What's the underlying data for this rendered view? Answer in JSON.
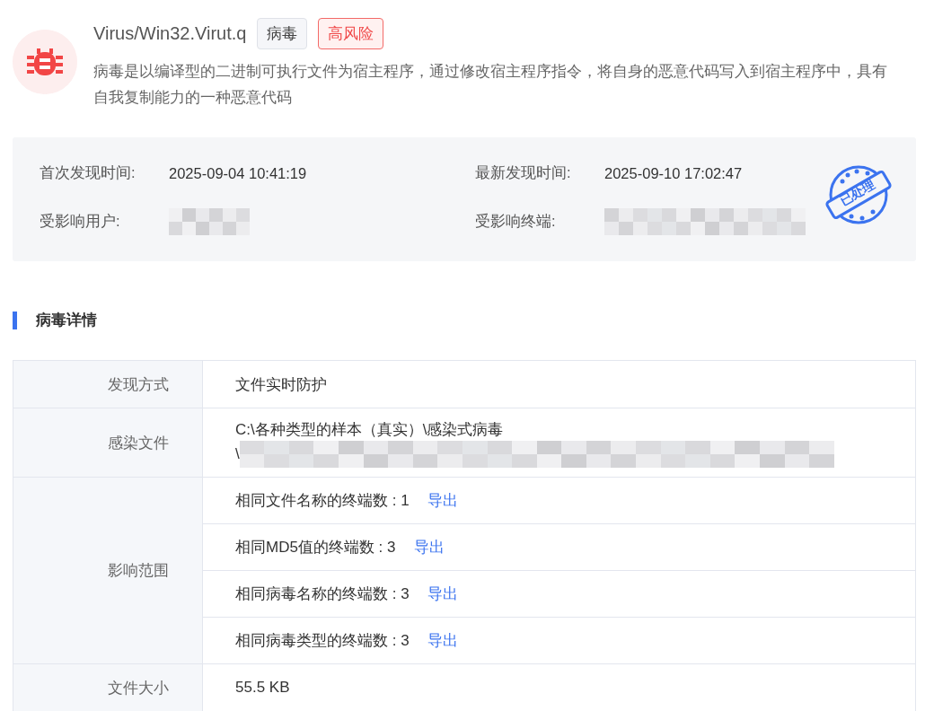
{
  "threat": {
    "name": "Virus/Win32.Virut.q",
    "tags": [
      {
        "label": "病毒",
        "kind": "type"
      },
      {
        "label": "高风险",
        "kind": "risk"
      }
    ],
    "description": "病毒是以编译型的二进制可执行文件为宿主程序，通过修改宿主程序指令，将自身的恶意代码写入到宿主程序中，具有自我复制能力的一种恶意代码"
  },
  "summary": {
    "fields": [
      {
        "label": "首次发现时间:",
        "value": "2025-09-04 10:41:19",
        "redacted": false
      },
      {
        "label": "最新发现时间:",
        "value": "2025-09-10 17:02:47",
        "redacted": false
      },
      {
        "label": "受影响用户:",
        "redacted": true
      },
      {
        "label": "受影响终端:",
        "redacted": true
      }
    ],
    "stamp": "已处理"
  },
  "section": {
    "title": "病毒详情"
  },
  "details": [
    {
      "label": "发现方式",
      "kind": "text",
      "lines": [
        "文件实时防护"
      ]
    },
    {
      "label": "感染文件",
      "kind": "path",
      "lines": [
        "C:\\各种类型的样本（真实）\\感染式病毒",
        "\\"
      ]
    },
    {
      "label": "影响范围",
      "kind": "counts",
      "items": [
        {
          "text": "相同文件名称的终端数 : 1",
          "link": "导出"
        },
        {
          "text": "相同MD5值的终端数 : 3",
          "link": "导出"
        },
        {
          "text": "相同病毒名称的终端数 : 3",
          "link": "导出"
        },
        {
          "text": "相同病毒类型的终端数 : 3",
          "link": "导出"
        }
      ]
    },
    {
      "label": "文件大小",
      "kind": "text",
      "lines": [
        "55.5 KB"
      ]
    }
  ]
}
